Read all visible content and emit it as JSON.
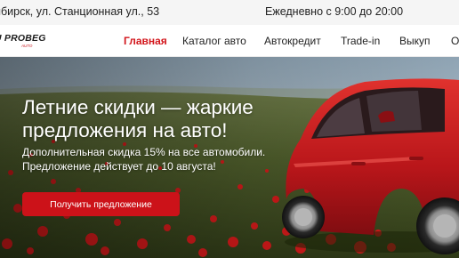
{
  "topbar": {
    "address": "ибирск, ул. Станционная ул., 53",
    "hours": "Ежедневно с 9:00 до 20:00"
  },
  "logo": {
    "main": "U PROBEG",
    "sub": "AUTO"
  },
  "nav": {
    "items": [
      {
        "label": "Главная",
        "active": true
      },
      {
        "label": "Каталог авто",
        "active": false
      },
      {
        "label": "Автокредит",
        "active": false
      },
      {
        "label": "Trade-in",
        "active": false
      },
      {
        "label": "Выкуп",
        "active": false
      },
      {
        "label": "О",
        "active": false
      }
    ]
  },
  "hero": {
    "title": "Летние скидки — жаркие предложения на авто!",
    "subtitle": "Дополнительная скидка 15% на все автомобили. Предложение действует до 10 августа!",
    "cta_label": "Получить предложение"
  },
  "colors": {
    "accent": "#d2151b",
    "button": "#cc1219",
    "topbar_bg": "#f5f5f5",
    "car": "#c81d1d"
  }
}
